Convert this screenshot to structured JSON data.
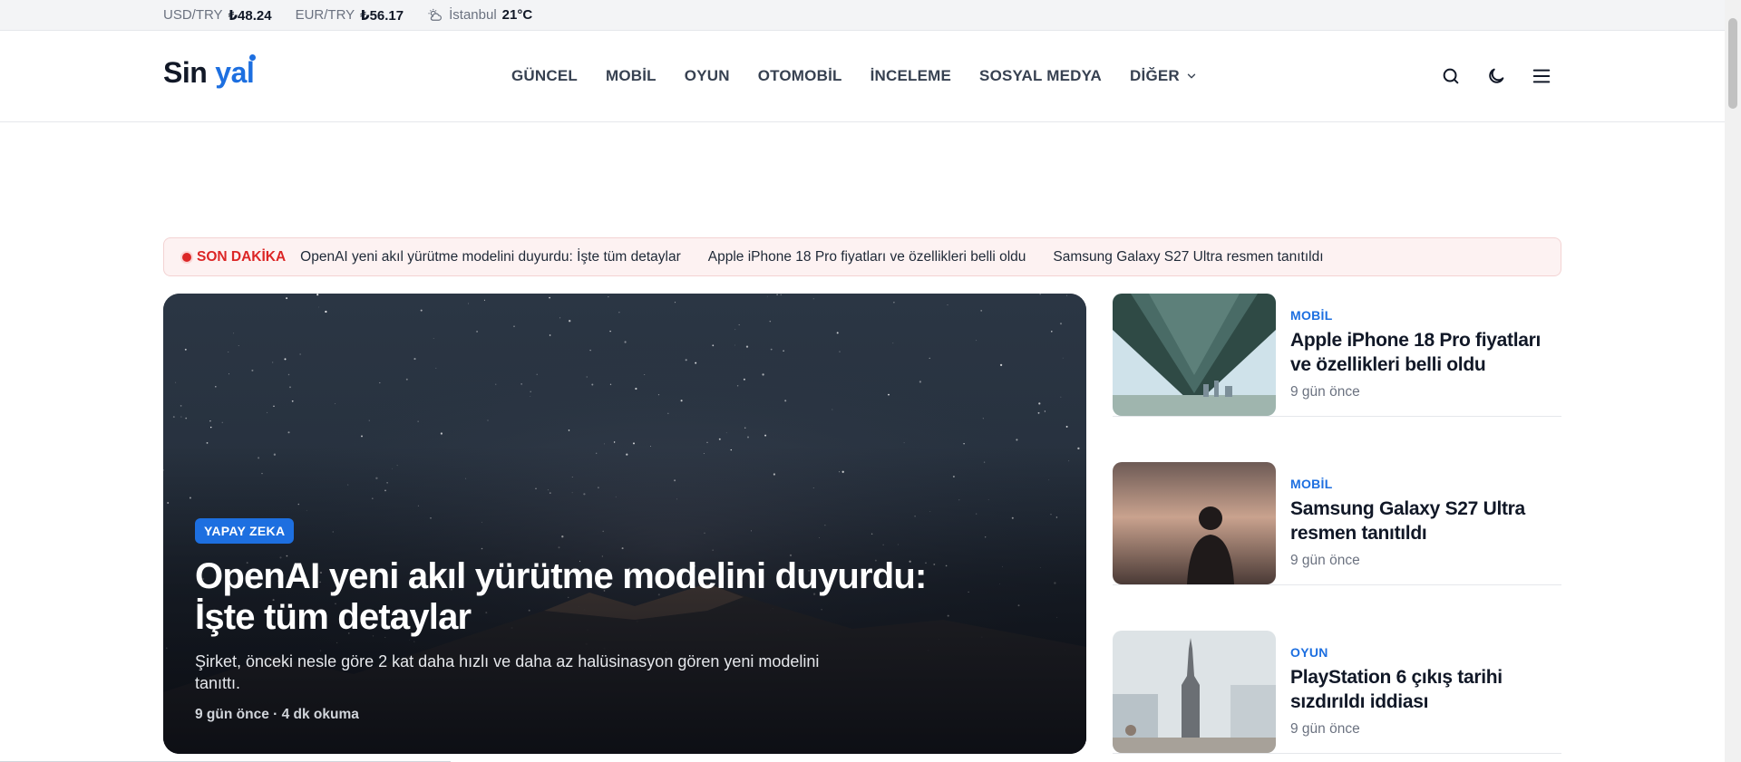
{
  "topbar": {
    "usd_label": "USD/TRY",
    "usd_value": "₺48.24",
    "eur_label": "EUR/TRY",
    "eur_value": "₺56.17",
    "city": "İstanbul",
    "temp": "21°C",
    "weather_icon": "partly-cloudy-icon"
  },
  "logo": {
    "part1": "Sin",
    "part2": "yal"
  },
  "nav": [
    {
      "label": "GÜNCEL"
    },
    {
      "label": "MOBİL"
    },
    {
      "label": "OYUN"
    },
    {
      "label": "OTOMOBİL"
    },
    {
      "label": "İNCELEME"
    },
    {
      "label": "SOSYAL MEDYA"
    },
    {
      "label": "DİĞER"
    }
  ],
  "header_icons": [
    "search-icon",
    "moon-icon",
    "menu-icon"
  ],
  "ticker": {
    "label": "SON DAKİKA",
    "items": [
      "OpenAI yeni akıl yürütme modelini duyurdu: İşte tüm detaylar",
      "Apple iPhone 18 Pro fiyatları ve özellikleri belli oldu",
      "Samsung Galaxy S27 Ultra resmen tanıtıldı"
    ]
  },
  "hero": {
    "badge": "YAPAY ZEKA",
    "title": "OpenAI yeni akıl yürütme modelini duyurdu: İşte tüm detaylar",
    "desc": "Şirket, önceki nesle göre 2 kat daha hızlı ve daha az halüsinasyon gören yeni modelini tanıttı.",
    "meta": "9 gün önce · 4 dk okuma"
  },
  "side": [
    {
      "category": "MOBİL",
      "title": "Apple iPhone 18 Pro fiyatları ve özellikleri belli oldu",
      "time": "9 gün önce"
    },
    {
      "category": "MOBİL",
      "title": "Samsung Galaxy S27 Ultra resmen tanıtıldı",
      "time": "9 gün önce"
    },
    {
      "category": "OYUN",
      "title": "PlayStation 6 çıkış tarihi sızdırıldı iddiası",
      "time": "9 gün önce"
    }
  ],
  "colors": {
    "accent": "#1d6fe0",
    "breaking": "#dc2626"
  }
}
